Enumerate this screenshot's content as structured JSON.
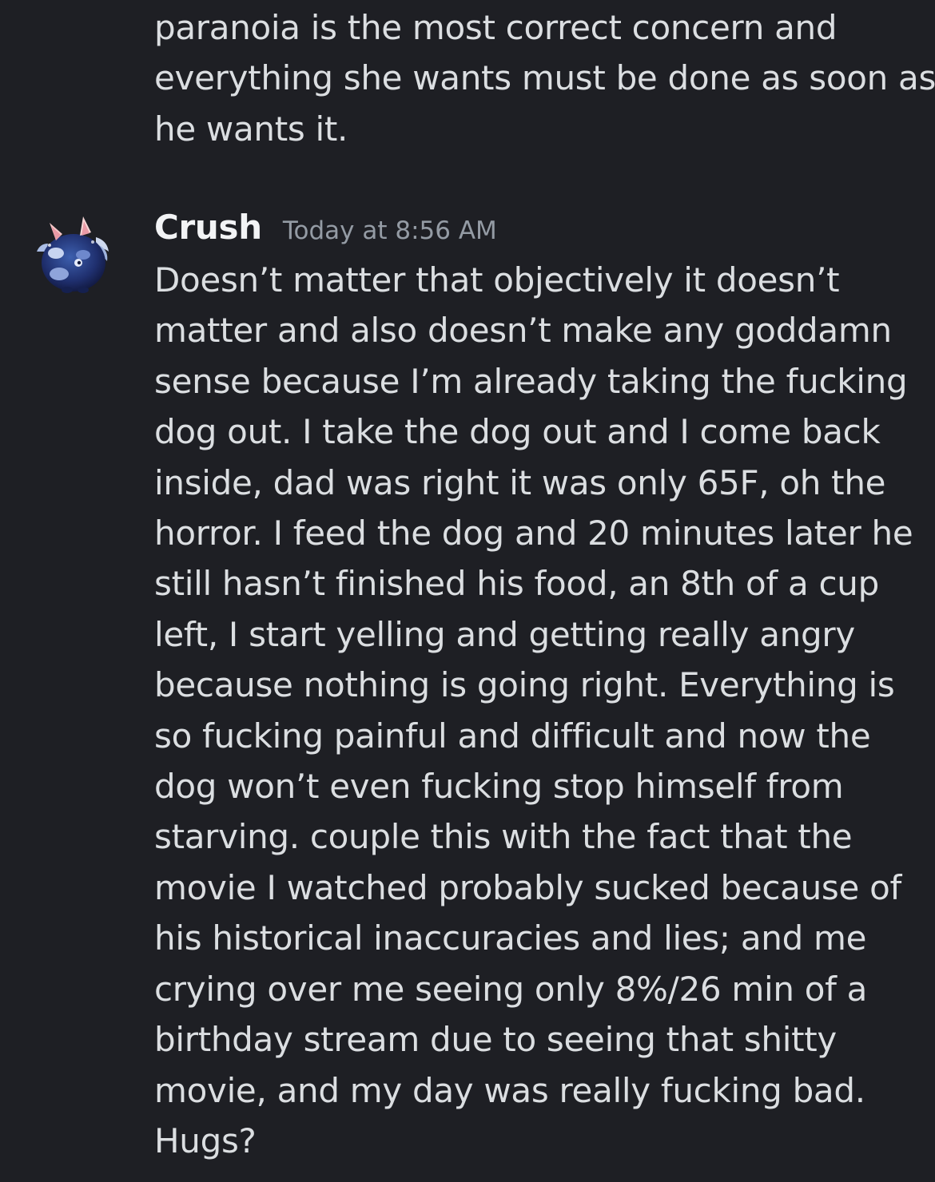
{
  "previous_message": {
    "lines": [
      "paranoia is the most correct concern and",
      "everything she wants must be done as soon as",
      "he wants it."
    ]
  },
  "message": {
    "avatar_icon": "blue-creature-avatar-icon",
    "username": "Crush",
    "timestamp": "Today at 8:56 AM",
    "lines": [
      "Doesn’t matter that objectively it doesn’t",
      "matter and also doesn’t make any goddamn",
      "sense because I’m already taking the fucking",
      "dog out. I take the dog out and I come back",
      "inside, dad was right it was only 65F, oh the",
      "horror. I feed the dog and 20 minutes later he",
      "still hasn’t finished his food, an 8th of a cup",
      "left, I start yelling and getting really angry",
      "because nothing is going right. Everything is",
      "so fucking painful and difficult and now the",
      "dog won’t even fucking stop himself from",
      "starving. couple this with the fact that the",
      "movie I watched probably sucked because of",
      "his historical inaccuracies and lies; and me",
      "crying over me seeing only 8%/26 min of a",
      "birthday stream due to seeing that shitty",
      "movie, and my day was really fucking bad.",
      "Hugs?"
    ]
  }
}
